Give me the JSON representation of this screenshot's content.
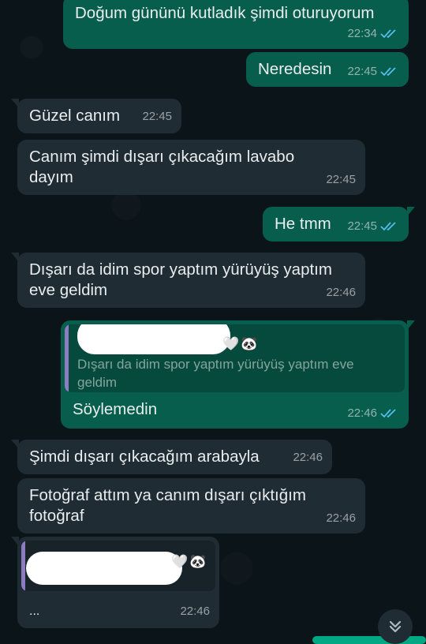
{
  "messages": [
    {
      "id": "m1",
      "dir": "out",
      "lines": [
        "Doğum gününü kutladık şimdi oturuyorum"
      ],
      "time": "22:34",
      "read": true
    },
    {
      "id": "m2",
      "dir": "out",
      "lines": [
        "Neredesin"
      ],
      "time": "22:45",
      "read": true
    },
    {
      "id": "m3",
      "dir": "in",
      "lines": [
        "Güzel canım"
      ],
      "time": "22:45"
    },
    {
      "id": "m4",
      "dir": "in",
      "lines": [
        "Canım şimdi dışarı çıkacağım lavabo",
        "dayım"
      ],
      "time": "22:45"
    },
    {
      "id": "m5",
      "dir": "out",
      "lines": [
        "He tmm"
      ],
      "time": "22:45",
      "read": true
    },
    {
      "id": "m6",
      "dir": "in",
      "lines": [
        "Dışarı da idim spor yaptım yürüyüş yaptım",
        "eve geldim"
      ],
      "time": "22:46"
    },
    {
      "id": "m7",
      "dir": "out",
      "lines": [
        "Söylemedin"
      ],
      "time": "22:46",
      "read": true,
      "quote": {
        "sender_suffix": "🤍🐼",
        "lines": [
          "Dışarı da idim spor yaptım yürüyüş yaptım eve",
          "geldim"
        ]
      }
    },
    {
      "id": "m8",
      "dir": "in",
      "lines": [
        "Şimdi dışarı çıkacağım arabayla"
      ],
      "time": "22:46"
    },
    {
      "id": "m9",
      "dir": "in",
      "lines": [
        "Fotoğraf attım ya canım dışarı çıktığım",
        "fotoğraf"
      ],
      "time": "22:46"
    },
    {
      "id": "m10",
      "dir": "in",
      "lines": [
        "..."
      ],
      "time": "22:46",
      "quote": {
        "sender_suffix": "🤍🐼",
        "lines": []
      }
    }
  ],
  "ui": {
    "scroll_down_icon": "chevron-double-down-icon",
    "read_tick_color": "#53bdeb"
  }
}
